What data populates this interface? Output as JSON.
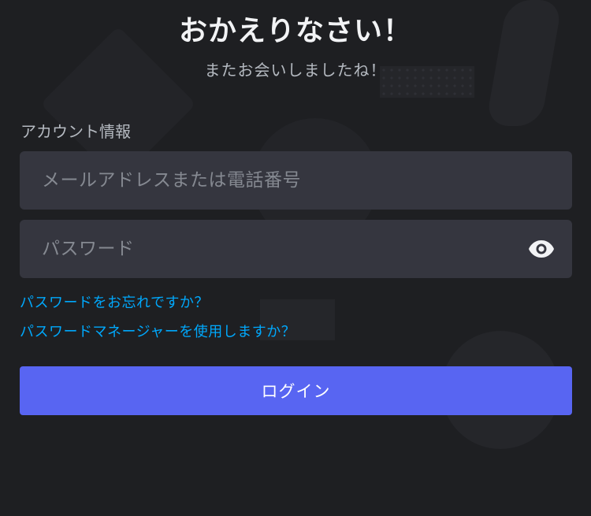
{
  "header": {
    "title": "おかえりなさい！",
    "subtitle": "またお会いしましたね！"
  },
  "form": {
    "section_label": "アカウント情報",
    "email": {
      "placeholder": "メールアドレスまたは電話番号",
      "value": ""
    },
    "password": {
      "placeholder": "パスワード",
      "value": "",
      "toggle_icon": "eye-icon"
    },
    "forgot_password_link": "パスワードをお忘れですか？",
    "password_manager_link": "パスワードマネージャーを使用しますか？",
    "login_button": "ログイン"
  },
  "colors": {
    "background": "#1e1f22",
    "field_background": "#35363f",
    "link": "#00a8fc",
    "button": "#5865f2",
    "text_primary": "#f2f3f5",
    "text_secondary": "#b5bac1",
    "placeholder": "#858991"
  }
}
